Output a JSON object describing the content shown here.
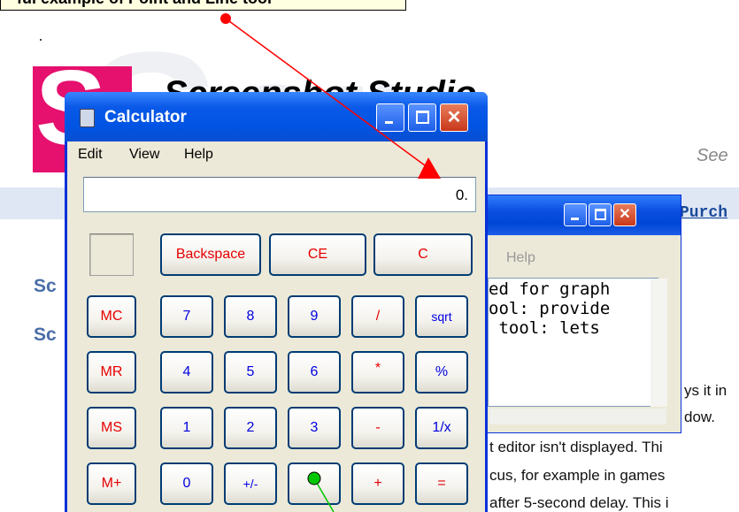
{
  "page": {
    "callout_text": "ful example of Point and Line tool",
    "brand_title": "Screenshot Studio",
    "see_text": "See",
    "nav_purchase": "Purch",
    "side_links": [
      "Sc",
      "Sc"
    ],
    "body_lines": [
      "ys it in",
      "dow.",
      "t editor isn't displayed. Thi",
      "cus, for example in games",
      "after 5-second delay. This i"
    ]
  },
  "notepad": {
    "menu_help": "Help",
    "text_lines": [
      "ed for graph",
      "ool: provide",
      " tool: lets"
    ]
  },
  "calculator": {
    "title": "Calculator",
    "menu": [
      "Edit",
      "View",
      "Help"
    ],
    "display_value": "0.",
    "buttons": {
      "backspace": "Backspace",
      "ce": "CE",
      "c": "C",
      "mc": "MC",
      "mr": "MR",
      "ms": "MS",
      "mplus": "M+",
      "b7": "7",
      "b8": "8",
      "b9": "9",
      "div": "/",
      "sqrt": "sqrt",
      "b4": "4",
      "b5": "5",
      "b6": "6",
      "mul": "*",
      "pct": "%",
      "b1": "1",
      "b2": "2",
      "b3": "3",
      "sub": "-",
      "inv": "1/x",
      "b0": "0",
      "sign": "+/-",
      "dot": "",
      "add": "+",
      "eq": "="
    }
  },
  "colors": {
    "title_bar": "#0054e3",
    "close_button": "#c8381a",
    "red_label": "#e50000",
    "blue_label": "#0000e0",
    "annotation_red": "#ff0000",
    "annotation_green": "#00c800",
    "logo_pink": "#e6106e"
  }
}
